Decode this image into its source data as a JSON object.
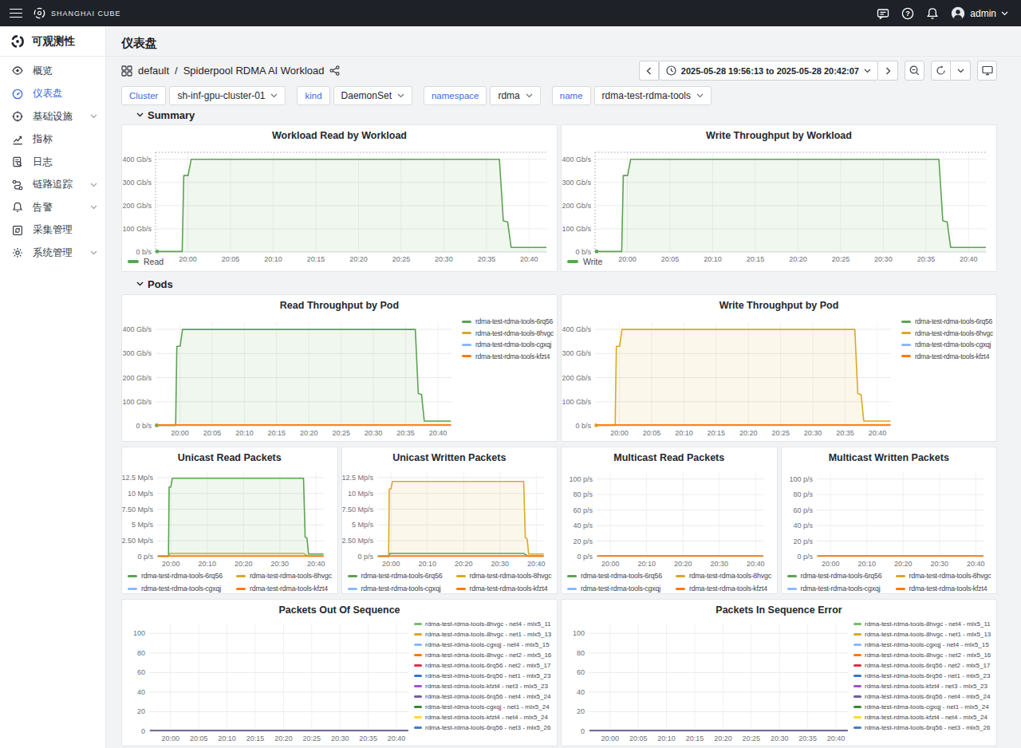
{
  "topbar": {
    "brand": "SHANGHAI CUBE",
    "user": "admin"
  },
  "sidebar": {
    "header": "可观测性",
    "items": [
      {
        "label": "概览",
        "icon": "eye",
        "active": false,
        "chevron": false
      },
      {
        "label": "仪表盘",
        "icon": "gauge",
        "active": true,
        "chevron": false
      },
      {
        "label": "基础设施",
        "icon": "infra",
        "active": false,
        "chevron": true
      },
      {
        "label": "指标",
        "icon": "metrics",
        "active": false,
        "chevron": false
      },
      {
        "label": "日志",
        "icon": "logs",
        "active": false,
        "chevron": false
      },
      {
        "label": "链路追踪",
        "icon": "trace",
        "active": false,
        "chevron": true
      },
      {
        "label": "告警",
        "icon": "bell",
        "active": false,
        "chevron": true
      },
      {
        "label": "采集管理",
        "icon": "collect",
        "active": false,
        "chevron": false
      },
      {
        "label": "系统管理",
        "icon": "gear",
        "active": false,
        "chevron": true
      }
    ]
  },
  "page": {
    "title": "仪表盘"
  },
  "breadcrumb": {
    "folder": "default",
    "sep": "/",
    "dashboard": "Spiderpool RDMA AI Workload"
  },
  "timebar": {
    "range": "2025-05-28 19:56:13 to 2025-05-28 20:42:07"
  },
  "filters": [
    {
      "label": "Cluster",
      "value": "sh-inf-gpu-cluster-01"
    },
    {
      "label": "kind",
      "value": "DaemonSet"
    },
    {
      "label": "namespace",
      "value": "rdma"
    },
    {
      "label": "name",
      "value": "rdma-test-rdma-tools"
    }
  ],
  "sections": {
    "summary": "Summary",
    "pods": "Pods"
  },
  "axes": {
    "x": {
      "t5": [
        [
          "20:00",
          0.0824
        ],
        [
          "20:05",
          0.1913
        ],
        [
          "20:10",
          0.3003
        ],
        [
          "20:15",
          0.4092
        ],
        [
          "20:20",
          0.5182
        ],
        [
          "20:25",
          0.6271
        ],
        [
          "20:30",
          0.736
        ],
        [
          "20:35",
          0.845
        ],
        [
          "20:40",
          0.9539
        ]
      ],
      "t10": [
        [
          "20:00",
          0.0824
        ],
        [
          "20:10",
          0.3003
        ],
        [
          "20:20",
          0.5182
        ],
        [
          "20:30",
          0.736
        ],
        [
          "20:40",
          0.9539
        ]
      ]
    },
    "y": {
      "thr": [
        [
          0,
          "0 b/s"
        ],
        [
          100,
          "100 Gb/s"
        ],
        [
          200,
          "200 Gb/s"
        ],
        [
          300,
          "300 Gb/s"
        ],
        [
          400,
          "400 Gb/s"
        ]
      ],
      "mpps": [
        [
          0,
          "0 p/s"
        ],
        [
          2.5,
          "2.50 Mp/s"
        ],
        [
          5,
          "5 Mp/s"
        ],
        [
          7.5,
          "7.50 Mp/s"
        ],
        [
          10,
          "10 Mp/s"
        ],
        [
          12.5,
          "12.5 Mp/s"
        ]
      ],
      "pps": [
        [
          0,
          "0 p/s"
        ],
        [
          20,
          "20 p/s"
        ],
        [
          40,
          "40 p/s"
        ],
        [
          60,
          "60 p/s"
        ],
        [
          80,
          "80 p/s"
        ],
        [
          100,
          "100 p/s"
        ]
      ],
      "plain": [
        [
          0,
          "0"
        ],
        [
          20,
          "20"
        ],
        [
          40,
          "40"
        ],
        [
          60,
          "60"
        ],
        [
          80,
          "80"
        ],
        [
          100,
          "100"
        ]
      ]
    }
  },
  "chart_shapes": {
    "thr_big": [
      [
        0.004,
        2
      ],
      [
        0.068,
        2
      ],
      [
        0.072,
        330
      ],
      [
        0.083,
        330
      ],
      [
        0.091,
        400
      ],
      [
        0.878,
        400
      ],
      [
        0.888,
        134
      ],
      [
        0.899,
        130
      ],
      [
        0.908,
        20
      ],
      [
        0.998,
        20
      ]
    ],
    "mp_big_read": [
      [
        0.004,
        0.06
      ],
      [
        0.068,
        0.06
      ],
      [
        0.072,
        11
      ],
      [
        0.082,
        11
      ],
      [
        0.091,
        12.4
      ],
      [
        0.878,
        12.4
      ],
      [
        0.888,
        3.1
      ],
      [
        0.899,
        2.9
      ],
      [
        0.908,
        0.42
      ],
      [
        0.998,
        0.42
      ]
    ],
    "mp_big_write": [
      [
        0.004,
        0.06
      ],
      [
        0.068,
        0.06
      ],
      [
        0.072,
        10.7
      ],
      [
        0.082,
        10.7
      ],
      [
        0.091,
        11.9
      ],
      [
        0.878,
        11.9
      ],
      [
        0.888,
        3.0
      ],
      [
        0.899,
        2.8
      ],
      [
        0.908,
        0.42
      ],
      [
        0.998,
        0.42
      ]
    ],
    "mp_small": [
      [
        0.004,
        0.05
      ],
      [
        0.07,
        0.05
      ],
      [
        0.076,
        0.5
      ],
      [
        0.878,
        0.5
      ],
      [
        0.905,
        0.07
      ],
      [
        0.998,
        0.07
      ]
    ],
    "flat_thr": [
      [
        0.004,
        4
      ],
      [
        0.998,
        4
      ]
    ],
    "flat_mp": [
      [
        0.004,
        0.1
      ],
      [
        0.998,
        0.1
      ]
    ],
    "flat_pps": [
      [
        0.004,
        0.8
      ],
      [
        0.998,
        0.8
      ]
    ],
    "flat_seq": [
      [
        0.004,
        0.6
      ],
      [
        0.998,
        0.6
      ]
    ]
  },
  "chart_data": [
    {
      "row": "summary",
      "type": "area",
      "title": "Workload Read by Workload",
      "layout": {
        "left": 42,
        "top": 34,
        "axis": 159,
        "right_inset": 12,
        "legend": "bottom",
        "dashed_frame": true
      },
      "ylim": [
        0,
        430
      ],
      "y_ticks": "thr",
      "x_ticks": "t5",
      "series": [
        {
          "name": "Read",
          "color": "#5CA352",
          "fill": true,
          "dot": true,
          "shape": "thr_big"
        }
      ]
    },
    {
      "row": "summary",
      "type": "area",
      "title": "Write Throughput by Workload",
      "layout": {
        "left": 42,
        "top": 34,
        "axis": 159,
        "right_inset": 12,
        "legend": "bottom",
        "dashed_frame": true
      },
      "ylim": [
        0,
        430
      ],
      "y_ticks": "thr",
      "x_ticks": "t5",
      "series": [
        {
          "name": "Write",
          "color": "#5CA352",
          "fill": true,
          "dot": true,
          "shape": "thr_big"
        }
      ]
    },
    {
      "row": "pods",
      "type": "area",
      "title": "Read Throughput by Pod",
      "layout": {
        "left": 42,
        "top": 34,
        "axis": 164,
        "right_inset": 132,
        "legend": "right",
        "dashed_frame": false
      },
      "ylim": [
        0,
        430
      ],
      "y_ticks": "thr",
      "x_ticks": "t5",
      "series": [
        {
          "name": "rdma-test-rdma-tools-6rq56",
          "color": "#5CA352",
          "fill": true,
          "dot": true,
          "shape": "thr_big"
        },
        {
          "name": "rdma-test-rdma-tools-8hvgc",
          "color": "#D9A826",
          "shape": "flat_thr"
        },
        {
          "name": "rdma-test-rdma-tools-cgxqj",
          "color": "#8AB8FF",
          "shape": "flat_thr"
        },
        {
          "name": "rdma-test-rdma-tools-kfzt4",
          "color": "#FF780A",
          "shape": "flat_thr",
          "z": 1
        }
      ]
    },
    {
      "row": "pods",
      "type": "area",
      "title": "Write Throughput by Pod",
      "layout": {
        "left": 42,
        "top": 34,
        "axis": 164,
        "right_inset": 132,
        "legend": "right",
        "dashed_frame": false
      },
      "ylim": [
        0,
        430
      ],
      "y_ticks": "thr",
      "x_ticks": "t5",
      "series": [
        {
          "name": "rdma-test-rdma-tools-6rq56",
          "color": "#5CA352",
          "shape": "flat_thr"
        },
        {
          "name": "rdma-test-rdma-tools-8hvgc",
          "color": "#DCA920",
          "fill": true,
          "dot": true,
          "shape": "thr_big"
        },
        {
          "name": "rdma-test-rdma-tools-cgxqj",
          "color": "#8AB8FF",
          "shape": "flat_thr"
        },
        {
          "name": "rdma-test-rdma-tools-kfzt4",
          "color": "#FF780A",
          "shape": "flat_thr",
          "z": 1
        }
      ]
    },
    {
      "row": "packets",
      "type": "area",
      "title": "Unicast Read Packets",
      "layout": {
        "left": 44,
        "top": 30,
        "axis": 137,
        "right_inset": 17,
        "legend": "grid",
        "dashed_frame": false
      },
      "ylim": [
        0,
        13.5
      ],
      "y_ticks": "mpps",
      "x_ticks": "t10",
      "series": [
        {
          "name": "rdma-test-rdma-tools-6rq56",
          "color": "#5CA352",
          "fill": true,
          "shape": "mp_big_read"
        },
        {
          "name": "rdma-test-rdma-tools-8hvgc",
          "color": "#D9A826",
          "shape": "mp_small"
        },
        {
          "name": "rdma-test-rdma-tools-cgxqj",
          "color": "#8AB8FF",
          "shape": "flat_mp"
        },
        {
          "name": "rdma-test-rdma-tools-kfzt4",
          "color": "#FF780A",
          "shape": "flat_mp",
          "z": 1
        }
      ]
    },
    {
      "row": "packets",
      "type": "area",
      "title": "Unicast Written Packets",
      "layout": {
        "left": 44,
        "top": 30,
        "axis": 137,
        "right_inset": 17,
        "legend": "grid",
        "dashed_frame": false
      },
      "ylim": [
        0,
        13.5
      ],
      "y_ticks": "mpps",
      "x_ticks": "t10",
      "series": [
        {
          "name": "rdma-test-rdma-tools-6rq56",
          "color": "#5CA352",
          "shape": "mp_small"
        },
        {
          "name": "rdma-test-rdma-tools-8hvgc",
          "color": "#DCA920",
          "fill": true,
          "shape": "mp_big_write"
        },
        {
          "name": "rdma-test-rdma-tools-cgxqj",
          "color": "#8AB8FF",
          "shape": "flat_mp"
        },
        {
          "name": "rdma-test-rdma-tools-kfzt4",
          "color": "#FF780A",
          "shape": "flat_mp",
          "z": 1
        }
      ]
    },
    {
      "row": "packets",
      "type": "line",
      "title": "Multicast Read Packets",
      "layout": {
        "left": 44,
        "top": 30,
        "axis": 137,
        "right_inset": 17,
        "legend": "grid",
        "dashed_frame": false
      },
      "ylim": [
        0,
        110
      ],
      "y_ticks": "pps",
      "x_ticks": "t10",
      "series": [
        {
          "name": "rdma-test-rdma-tools-6rq56",
          "color": "#5CA352",
          "shape": "flat_pps"
        },
        {
          "name": "rdma-test-rdma-tools-8hvgc",
          "color": "#D9A826",
          "shape": "flat_pps"
        },
        {
          "name": "rdma-test-rdma-tools-cgxqj",
          "color": "#8AB8FF",
          "shape": "flat_pps"
        },
        {
          "name": "rdma-test-rdma-tools-kfzt4",
          "color": "#FF780A",
          "shape": "flat_pps",
          "z": 1
        }
      ]
    },
    {
      "row": "packets",
      "type": "line",
      "title": "Multicast Written Packets",
      "layout": {
        "left": 44,
        "top": 30,
        "axis": 137,
        "right_inset": 17,
        "legend": "grid",
        "dashed_frame": false
      },
      "ylim": [
        0,
        110
      ],
      "y_ticks": "pps",
      "x_ticks": "t10",
      "series": [
        {
          "name": "rdma-test-rdma-tools-6rq56",
          "color": "#5CA352",
          "shape": "flat_pps"
        },
        {
          "name": "rdma-test-rdma-tools-8hvgc",
          "color": "#D9A826",
          "shape": "flat_pps"
        },
        {
          "name": "rdma-test-rdma-tools-cgxqj",
          "color": "#8AB8FF",
          "shape": "flat_pps"
        },
        {
          "name": "rdma-test-rdma-tools-kfzt4",
          "color": "#FF780A",
          "shape": "flat_pps",
          "z": 1
        }
      ]
    },
    {
      "row": "seq",
      "type": "line",
      "title": "Packets Out Of Sequence",
      "layout": {
        "left": 34,
        "top": 30,
        "axis": 165,
        "right_inset": 186,
        "legend": "right-sm",
        "dashed_frame": false
      },
      "ylim": [
        0,
        110
      ],
      "y_ticks": "plain",
      "x_ticks": "t5",
      "series": [
        {
          "name": "rdma-test-rdma-tools-8hvgc - net4 - mlx5_11",
          "color": "#73BF69",
          "shape": "flat_seq"
        },
        {
          "name": "rdma-test-rdma-tools-8hvgc - net1 - mlx5_13",
          "color": "#D9A826",
          "shape": "flat_seq"
        },
        {
          "name": "rdma-test-rdma-tools-cgxqj - net4 - mlx5_15",
          "color": "#8AB8FF",
          "shape": "flat_seq"
        },
        {
          "name": "rdma-test-rdma-tools-8hvgc - net2 - mlx5_16",
          "color": "#FF780A",
          "shape": "flat_seq"
        },
        {
          "name": "rdma-test-rdma-tools-6rq56 - net2 - mlx5_17",
          "color": "#E02F44",
          "shape": "flat_seq"
        },
        {
          "name": "rdma-test-rdma-tools-6rq56 - net1 - mlx5_23",
          "color": "#3274D9",
          "shape": "flat_seq"
        },
        {
          "name": "rdma-test-rdma-tools-kfzt4 - net3 - mlx5_23",
          "color": "#A352CC",
          "shape": "flat_seq"
        },
        {
          "name": "rdma-test-rdma-tools-6rq56 - net4 - mlx5_24",
          "color": "#705DA0",
          "shape": "flat_seq",
          "z": 1
        },
        {
          "name": "rdma-test-rdma-tools-cgxqj - net1 - mlx5_24",
          "color": "#37872D",
          "shape": "flat_seq"
        },
        {
          "name": "rdma-test-rdma-tools-kfzt4 - net4 - mlx5_24",
          "color": "#FADE2A",
          "shape": "flat_seq"
        },
        {
          "name": "rdma-test-rdma-tools-6rq56 - net3 - mlx5_26",
          "color": "#447EBC",
          "shape": "flat_seq"
        }
      ]
    },
    {
      "row": "seq",
      "type": "line",
      "title": "Packets In Sequence Error",
      "layout": {
        "left": 34,
        "top": 30,
        "axis": 165,
        "right_inset": 186,
        "legend": "right-sm",
        "dashed_frame": false
      },
      "ylim": [
        0,
        110
      ],
      "y_ticks": "plain",
      "x_ticks": "t5",
      "series": [
        {
          "name": "rdma-test-rdma-tools-8hvgc - net4 - mlx5_11",
          "color": "#73BF69",
          "shape": "flat_seq"
        },
        {
          "name": "rdma-test-rdma-tools-8hvgc - net1 - mlx5_13",
          "color": "#D9A826",
          "shape": "flat_seq"
        },
        {
          "name": "rdma-test-rdma-tools-cgxqj - net4 - mlx5_15",
          "color": "#8AB8FF",
          "shape": "flat_seq"
        },
        {
          "name": "rdma-test-rdma-tools-8hvgc - net2 - mlx5_16",
          "color": "#FF780A",
          "shape": "flat_seq"
        },
        {
          "name": "rdma-test-rdma-tools-6rq56 - net2 - mlx5_17",
          "color": "#E02F44",
          "shape": "flat_seq"
        },
        {
          "name": "rdma-test-rdma-tools-6rq56 - net1 - mlx5_23",
          "color": "#3274D9",
          "shape": "flat_seq"
        },
        {
          "name": "rdma-test-rdma-tools-kfzt4 - net3 - mlx5_23",
          "color": "#A352CC",
          "shape": "flat_seq"
        },
        {
          "name": "rdma-test-rdma-tools-6rq56 - net4 - mlx5_24",
          "color": "#705DA0",
          "shape": "flat_seq",
          "z": 1
        },
        {
          "name": "rdma-test-rdma-tools-cgxqj - net1 - mlx5_24",
          "color": "#37872D",
          "shape": "flat_seq"
        },
        {
          "name": "rdma-test-rdma-tools-kfzt4 - net4 - mlx5_24",
          "color": "#FADE2A",
          "shape": "flat_seq"
        },
        {
          "name": "rdma-test-rdma-tools-6rq56 - net3 - mlx5_26",
          "color": "#447EBC",
          "shape": "flat_seq"
        }
      ]
    }
  ]
}
